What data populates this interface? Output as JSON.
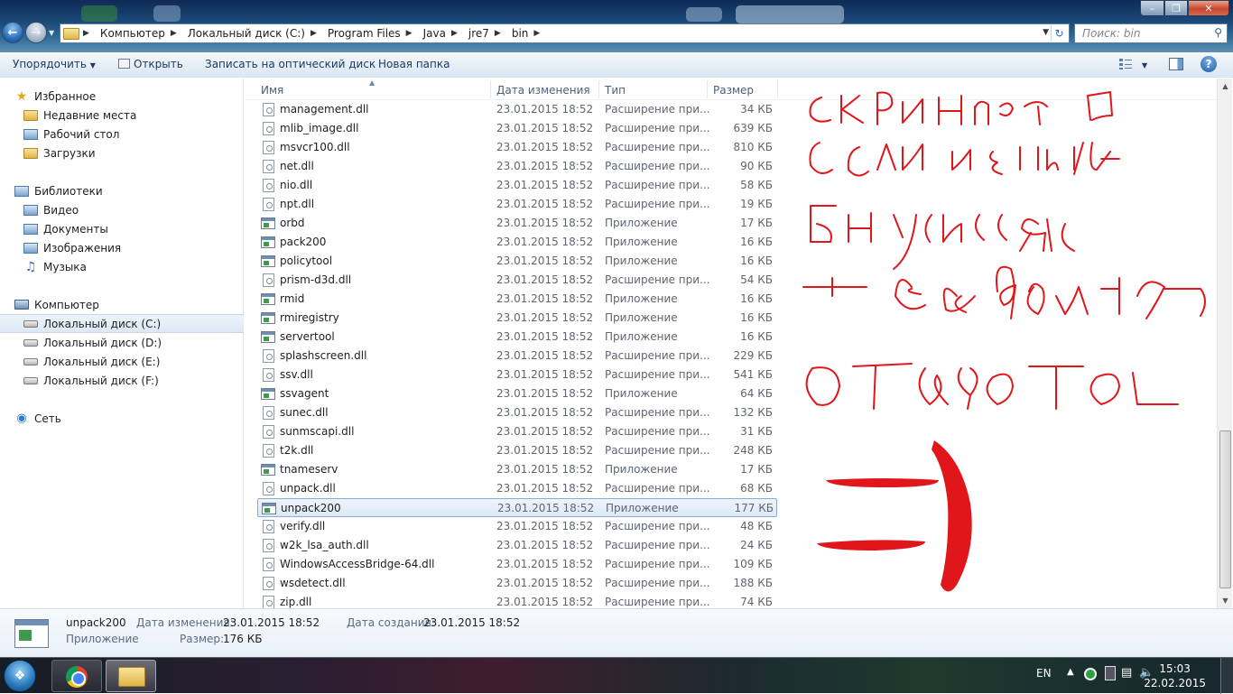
{
  "address": {
    "crumbs": [
      "Компьютер",
      "Локальный диск (C:)",
      "Program Files",
      "Java",
      "jre7",
      "bin"
    ]
  },
  "search": {
    "placeholder": "Поиск: bin"
  },
  "toolbar": {
    "organize": "Упорядочить",
    "open": "Открыть",
    "burn": "Записать на оптический диск",
    "new_folder": "Новая папка"
  },
  "nav": {
    "favorites": {
      "label": "Избранное",
      "items": [
        "Недавние места",
        "Рабочий стол",
        "Загрузки"
      ]
    },
    "libraries": {
      "label": "Библиотеки",
      "items": [
        "Видео",
        "Документы",
        "Изображения",
        "Музыка"
      ]
    },
    "computer": {
      "label": "Компьютер",
      "items": [
        "Локальный диск (C:)",
        "Локальный диск (D:)",
        "Локальный диск (E:)",
        "Локальный диск (F:)"
      ]
    },
    "network": {
      "label": "Сеть"
    }
  },
  "columns": {
    "name": "Имя",
    "date": "Дата изменения",
    "type": "Тип",
    "size": "Размер"
  },
  "files": [
    {
      "name": "management.dll",
      "date": "23.01.2015 18:52",
      "type": "Расширение при...",
      "size": "34 КБ",
      "kind": "dll"
    },
    {
      "name": "mlib_image.dll",
      "date": "23.01.2015 18:52",
      "type": "Расширение при...",
      "size": "639 КБ",
      "kind": "dll"
    },
    {
      "name": "msvcr100.dll",
      "date": "23.01.2015 18:52",
      "type": "Расширение при...",
      "size": "810 КБ",
      "kind": "dll"
    },
    {
      "name": "net.dll",
      "date": "23.01.2015 18:52",
      "type": "Расширение при...",
      "size": "90 КБ",
      "kind": "dll"
    },
    {
      "name": "nio.dll",
      "date": "23.01.2015 18:52",
      "type": "Расширение при...",
      "size": "58 КБ",
      "kind": "dll"
    },
    {
      "name": "npt.dll",
      "date": "23.01.2015 18:52",
      "type": "Расширение при...",
      "size": "19 КБ",
      "kind": "dll"
    },
    {
      "name": "orbd",
      "date": "23.01.2015 18:52",
      "type": "Приложение",
      "size": "17 КБ",
      "kind": "exe"
    },
    {
      "name": "pack200",
      "date": "23.01.2015 18:52",
      "type": "Приложение",
      "size": "16 КБ",
      "kind": "exe"
    },
    {
      "name": "policytool",
      "date": "23.01.2015 18:52",
      "type": "Приложение",
      "size": "16 КБ",
      "kind": "exe"
    },
    {
      "name": "prism-d3d.dll",
      "date": "23.01.2015 18:52",
      "type": "Расширение при...",
      "size": "54 КБ",
      "kind": "dll"
    },
    {
      "name": "rmid",
      "date": "23.01.2015 18:52",
      "type": "Приложение",
      "size": "16 КБ",
      "kind": "exe"
    },
    {
      "name": "rmiregistry",
      "date": "23.01.2015 18:52",
      "type": "Приложение",
      "size": "16 КБ",
      "kind": "exe"
    },
    {
      "name": "servertool",
      "date": "23.01.2015 18:52",
      "type": "Приложение",
      "size": "16 КБ",
      "kind": "exe"
    },
    {
      "name": "splashscreen.dll",
      "date": "23.01.2015 18:52",
      "type": "Расширение при...",
      "size": "229 КБ",
      "kind": "dll"
    },
    {
      "name": "ssv.dll",
      "date": "23.01.2015 18:52",
      "type": "Расширение при...",
      "size": "541 КБ",
      "kind": "dll"
    },
    {
      "name": "ssvagent",
      "date": "23.01.2015 18:52",
      "type": "Приложение",
      "size": "64 КБ",
      "kind": "exe"
    },
    {
      "name": "sunec.dll",
      "date": "23.01.2015 18:52",
      "type": "Расширение при...",
      "size": "132 КБ",
      "kind": "dll"
    },
    {
      "name": "sunmscapi.dll",
      "date": "23.01.2015 18:52",
      "type": "Расширение при...",
      "size": "31 КБ",
      "kind": "dll"
    },
    {
      "name": "t2k.dll",
      "date": "23.01.2015 18:52",
      "type": "Расширение при...",
      "size": "248 КБ",
      "kind": "dll"
    },
    {
      "name": "tnameserv",
      "date": "23.01.2015 18:52",
      "type": "Приложение",
      "size": "17 КБ",
      "kind": "exe"
    },
    {
      "name": "unpack.dll",
      "date": "23.01.2015 18:52",
      "type": "Расширение при...",
      "size": "68 КБ",
      "kind": "dll"
    },
    {
      "name": "unpack200",
      "date": "23.01.2015 18:52",
      "type": "Приложение",
      "size": "177 КБ",
      "kind": "exe",
      "selected": true
    },
    {
      "name": "verify.dll",
      "date": "23.01.2015 18:52",
      "type": "Расширение при...",
      "size": "48 КБ",
      "kind": "dll"
    },
    {
      "name": "w2k_lsa_auth.dll",
      "date": "23.01.2015 18:52",
      "type": "Расширение при...",
      "size": "24 КБ",
      "kind": "dll"
    },
    {
      "name": "WindowsAccessBridge-64.dll",
      "date": "23.01.2015 18:52",
      "type": "Расширение при...",
      "size": "109 КБ",
      "kind": "dll"
    },
    {
      "name": "wsdetect.dll",
      "date": "23.01.2015 18:52",
      "type": "Расширение при...",
      "size": "188 КБ",
      "kind": "dll"
    },
    {
      "name": "zip.dll",
      "date": "23.01.2015 18:52",
      "type": "Расширение при...",
      "size": "74 КБ",
      "kind": "dll"
    }
  ],
  "details": {
    "name": "unpack200",
    "type": "Приложение",
    "modified_label": "Дата изменения:",
    "modified": "23.01.2015 18:52",
    "created_label": "Дата создания:",
    "created": "23.01.2015 18:52",
    "size_label": "Размер:",
    "size": "176 КБ"
  },
  "taskbar": {
    "language": "EN",
    "time": "15:03",
    "date": "22.02.2015"
  },
  "colors": {
    "scribble": "#e0161a",
    "selection": "#dce9f7"
  }
}
